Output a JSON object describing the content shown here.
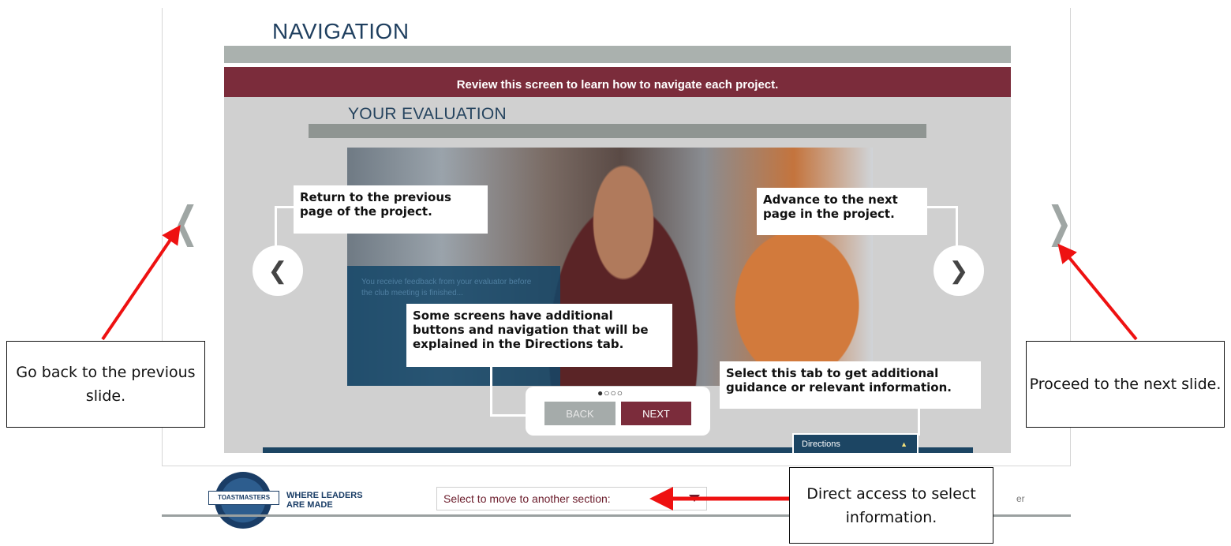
{
  "header": {
    "title": "NAVIGATION"
  },
  "slide": {
    "banner": "Review this screen to learn how to navigate each project.",
    "subtitle": "YOUR EVALUATION",
    "photo_panel_text": "You receive feedback from your evaluator before the club meeting is finished..."
  },
  "callouts": {
    "previous": "Return to the previous page of the project.",
    "next": "Advance to the next page in the project.",
    "additional": "Some screens have additional buttons and navigation that will be explained in the Directions tab.",
    "tab": "Select this tab to get additional guidance or relevant information."
  },
  "slide_nav": {
    "prev_glyph": "❮",
    "next_glyph": "❯",
    "dots": "●○○○",
    "back_label": "BACK",
    "next_label": "NEXT"
  },
  "directions_tab": {
    "label": "Directions",
    "arrow": "▲"
  },
  "side_nav": {
    "prev_glyph": "❮",
    "next_glyph": "❯"
  },
  "annotations": {
    "left": "Go back to the previous slide.",
    "right": "Proceed to the next slide.",
    "bottom": "Direct access to select information."
  },
  "footer": {
    "logo_text": "TOASTMASTERS",
    "tagline_line1": "WHERE LEADERS",
    "tagline_line2": "ARE MADE",
    "section_select_value": "Select to move to another section:",
    "right_text": "er"
  },
  "colors": {
    "accent_maroon": "#7b2c3b",
    "navy": "#1c4563",
    "arrow_red": "#ee1111",
    "panel_gray": "#d0d0d0"
  },
  "icons": [
    "chevron-left-icon",
    "chevron-right-icon",
    "dropdown-arrow-icon",
    "toastmasters-logo",
    "red-arrow"
  ]
}
